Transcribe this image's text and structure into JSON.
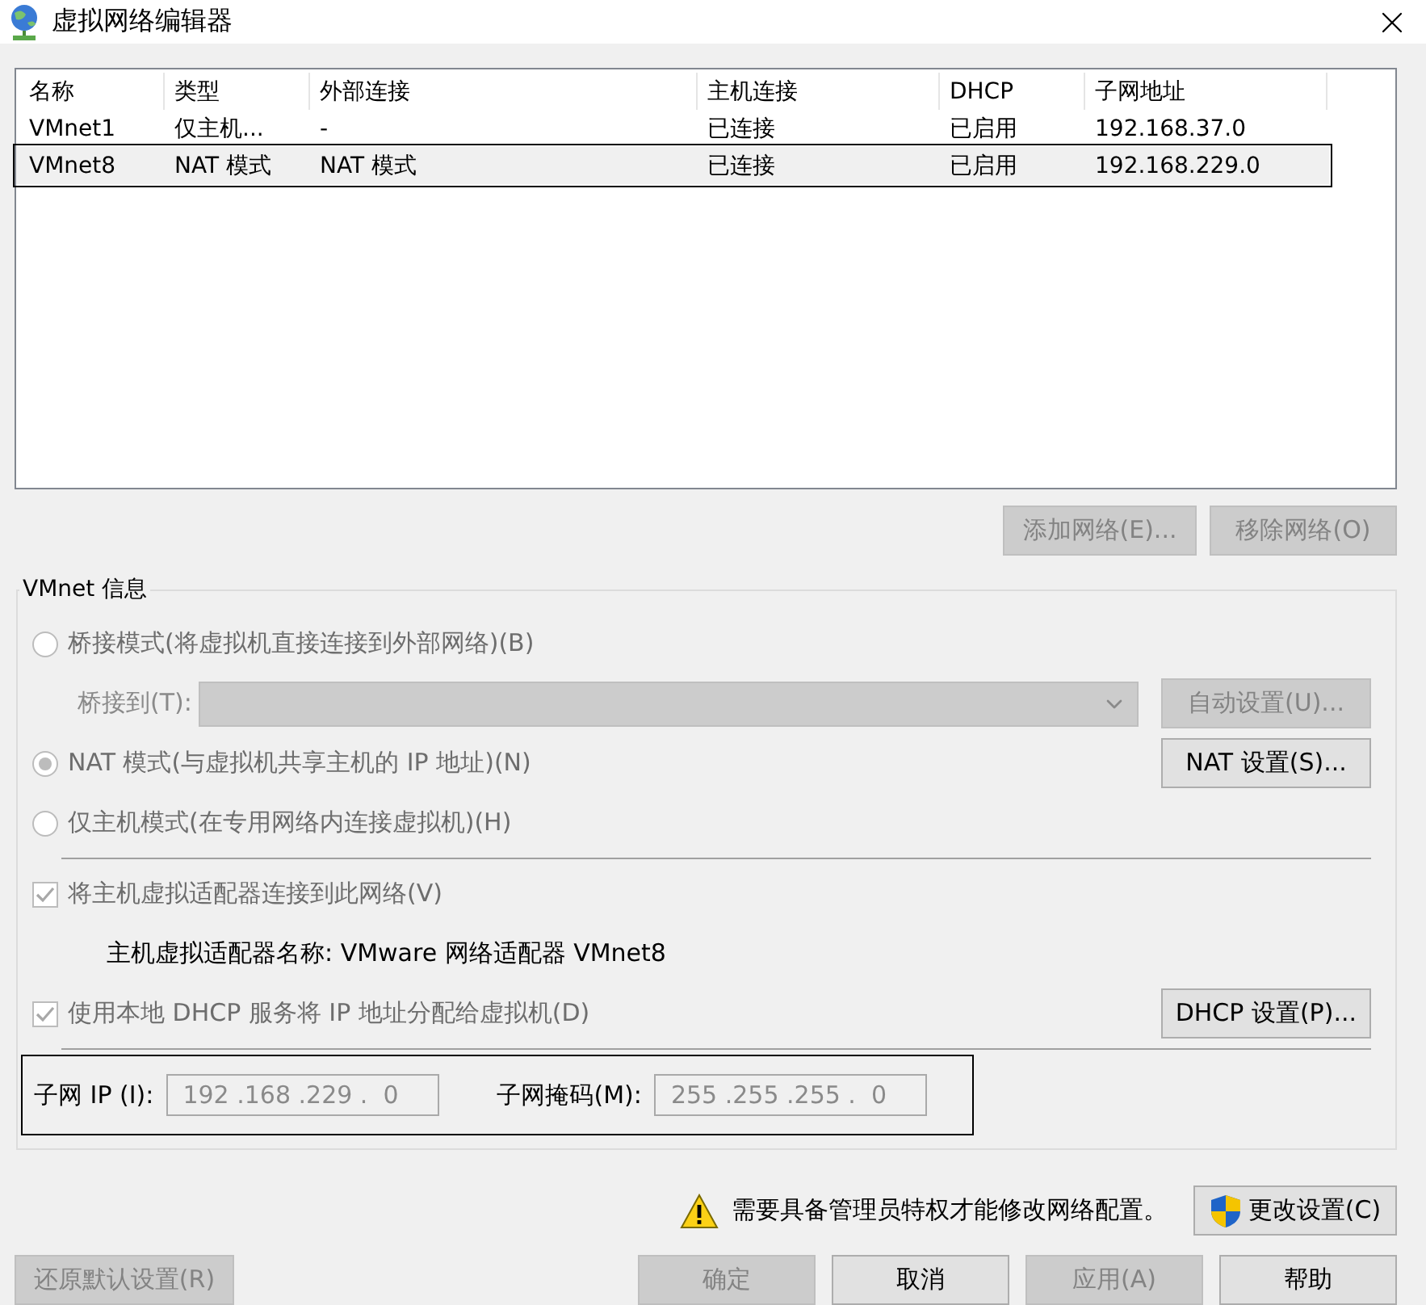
{
  "window": {
    "title": "虚拟网络编辑器"
  },
  "table": {
    "columns": [
      "名称",
      "类型",
      "外部连接",
      "主机连接",
      "DHCP",
      "子网地址"
    ],
    "rows": [
      {
        "cells": [
          "VMnet1",
          "仅主机...",
          "-",
          "已连接",
          "已启用",
          "192.168.37.0"
        ],
        "selected": false,
        "highlighted": false
      },
      {
        "cells": [
          "VMnet8",
          "NAT 模式",
          "NAT 模式",
          "已连接",
          "已启用",
          "192.168.229.0"
        ],
        "selected": true,
        "highlighted": true
      }
    ]
  },
  "table_buttons": [
    {
      "label": "添加网络(E)...",
      "disabled": true
    },
    {
      "label": "移除网络(O)",
      "disabled": true
    }
  ],
  "vmnet_info": {
    "title": "VMnet 信息",
    "bridged": {
      "label": "桥接模式(将虚拟机直接连接到外部网络)(B)",
      "selected": false,
      "disabled": true
    },
    "bridge_to": {
      "label": "桥接到(T):",
      "disabled": true
    },
    "auto_button": {
      "label": "自动设置(U)...",
      "disabled": true
    },
    "nat": {
      "label": "NAT 模式(与虚拟机共享主机的 IP 地址)(N)",
      "selected": true,
      "disabled": true
    },
    "nat_button": {
      "label": "NAT 设置(S)...",
      "disabled": false
    },
    "host_only": {
      "label": "仅主机模式(在专用网络内连接虚拟机)(H)",
      "selected": false,
      "disabled": true
    },
    "connect_adapter": {
      "label": "将主机虚拟适配器连接到此网络(V)",
      "checked": true,
      "disabled": true
    },
    "adapter_name": "主机虚拟适配器名称: VMware 网络适配器 VMnet8",
    "dhcp": {
      "label": "使用本地 DHCP 服务将 IP 地址分配给虚拟机(D)",
      "checked": true,
      "disabled": true
    },
    "dhcp_button": {
      "label": "DHCP 设置(P)...",
      "disabled": false
    },
    "subnet": {
      "highlighted": true,
      "ip_label": "子网 IP (I):",
      "ip_value": "192 .168 .229 .  0",
      "mask_label": "子网掩码(M):",
      "mask_value": "255 .255 .255 .  0"
    }
  },
  "warning": {
    "text": "需要具备管理员特权才能修改网络配置。"
  },
  "change_button": {
    "label": "更改设置(C)",
    "disabled": false
  },
  "footer": {
    "restore": {
      "label": "还原默认设置(R)",
      "disabled": true
    },
    "buttons": [
      {
        "label": "确定",
        "disabled": true
      },
      {
        "label": "取消",
        "disabled": false
      },
      {
        "label": "应用(A)",
        "disabled": true
      },
      {
        "label": "帮助",
        "disabled": false
      }
    ]
  }
}
